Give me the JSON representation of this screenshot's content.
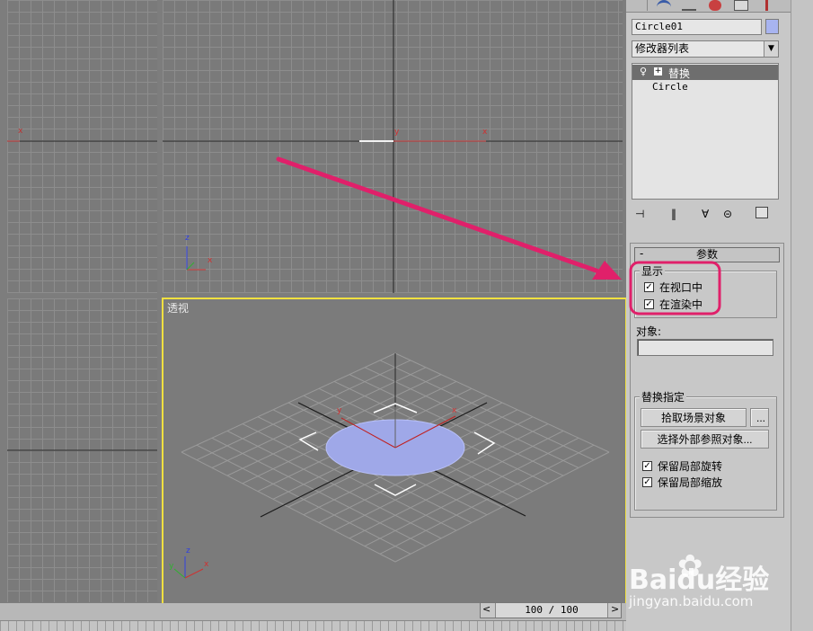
{
  "viewports": {
    "top_label": "",
    "perspective_label": "透视",
    "axis_x": "x",
    "axis_y": "y",
    "axis_z": "z"
  },
  "timeline": {
    "frame_readout": "100 / 100",
    "prev_label": "<",
    "next_label": ">"
  },
  "command_panel": {
    "object_name": "Circle01",
    "modifier_list": "修改器列表",
    "stack": [
      {
        "label": "替换",
        "selected": true
      },
      {
        "label": "Circle",
        "selected": false
      }
    ]
  },
  "parameters": {
    "rollout_title": "参数",
    "rollout_toggle": "-",
    "display_group": "显示",
    "in_viewport": "在视口中",
    "in_viewport_checked": true,
    "in_render": "在渲染中",
    "in_render_checked": true,
    "object_label": "对象:",
    "object_value": "",
    "replace_group": "替换指定",
    "pick_scene_button": "拾取场景对象",
    "ellipsis_button": "...",
    "xref_button": "选择外部参照对象...",
    "keep_rotation": "保留局部旋转",
    "keep_rotation_checked": true,
    "keep_scale": "保留局部缩放",
    "keep_scale_checked": true
  },
  "watermark": {
    "brand": "Baidu经验",
    "url": "jingyan.baidu.com"
  },
  "colors": {
    "viewport_bg": "#7a7a7a",
    "grid": "#8d8d8d",
    "active_border": "#f0e040",
    "circle_fill": "#9fa8e8",
    "annotation": "#e0206a",
    "panel_bg": "#c8c8c8"
  }
}
